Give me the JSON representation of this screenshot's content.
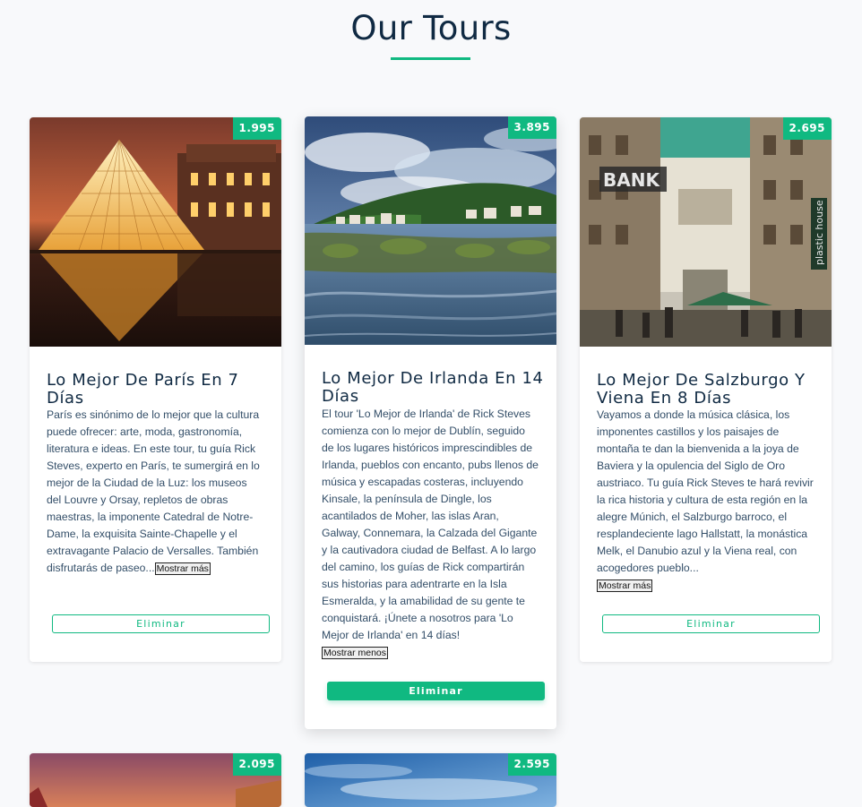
{
  "page": {
    "title": "Our Tours"
  },
  "colors": {
    "accent": "#10b981",
    "title": "#102a43",
    "text": "#334e68",
    "background": "#f8f9fb"
  },
  "tours": [
    {
      "price": "1.995",
      "title": "Lo Mejor De París En 7 Días",
      "description": "París es sinónimo de lo mejor que la cultura puede ofrecer: arte, moda, gastronomía, literatura e ideas. En este tour, tu guía Rick Steves, experto en París, te sumergirá en lo mejor de la Ciudad de la Luz: los museos del Louvre y Orsay, repletos de obras maestras, la imponente Catedral de Notre-Dame, la exquisita Sainte-Chapelle y el extravagante Palacio de Versalles. También disfrutarás de paseo...",
      "toggle": "Mostrar más",
      "delete": "Eliminar",
      "image": "louvre-pyramid-night"
    },
    {
      "price": "3.895",
      "title": "Lo Mejor De Irlanda En 14 Días",
      "description": "El tour 'Lo Mejor de Irlanda' de Rick Steves comienza con lo mejor de Dublín, seguido de los lugares históricos imprescindibles de Irlanda, pueblos con encanto, pubs llenos de música y escapadas costeras, incluyendo Kinsale, la península de Dingle, los acantilados de Moher, las islas Aran, Galway, Connemara, la Calzada del Gigante y la cautivadora ciudad de Belfast. A lo largo del camino, los guías de Rick compartirán sus historias para adentrarte en la Isla Esmeralda, y la amabilidad de su gente te conquistará. ¡Únete a nosotros para 'Lo Mejor de Irlanda' en 14 días!",
      "toggle": "Mostrar menos",
      "delete": "Eliminar",
      "image": "irish-coast"
    },
    {
      "price": "2.695",
      "title": "Lo Mejor De Salzburgo Y Viena En 8 Días",
      "description": "Vayamos a donde la música clásica, los imponentes castillos y los paisajes de montaña te dan la bienvenida a la joya de Baviera y la opulencia del Siglo de Oro austriaco. Tu guía Rick Steves te hará revivir la rica historia y cultura de esta región en la alegre Múnich, el Salzburgo barroco, el resplandeciente lago Hallstatt, la monástica Melk, el Danubio azul y la Viena real, con acogedores pueblo...",
      "toggle": "Mostrar más",
      "delete": "Eliminar",
      "image": "vienna-street",
      "image_text": [
        "BANK",
        "plastic house"
      ]
    },
    {
      "price": "2.095",
      "image": "sunset-city"
    },
    {
      "price": "2.595",
      "image": "blue-sky"
    }
  ]
}
